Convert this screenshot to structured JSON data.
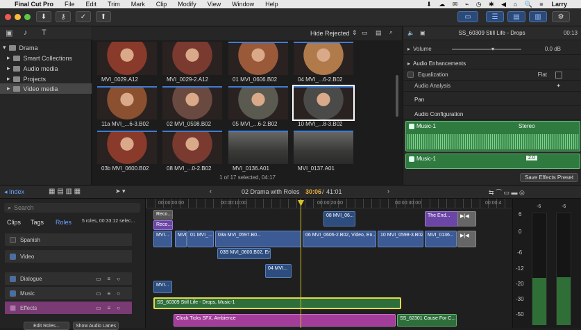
{
  "menubar": {
    "app": "Final Cut Pro",
    "items": [
      "File",
      "Edit",
      "Trim",
      "Mark",
      "Clip",
      "Modify",
      "View",
      "Window",
      "Help"
    ],
    "user": "Larry"
  },
  "library": {
    "name": "Drama",
    "items": [
      "Smart Collections",
      "Audio media",
      "Projects",
      "Video media"
    ],
    "selected": "Video media"
  },
  "browser": {
    "filter": "Hide Rejected",
    "status": "1 of 17 selected, 04:17",
    "clips": [
      "MVI_0029.A12",
      "MVI_0029-2.A12",
      "01 MVI_0606.B02",
      "04 MVI_...6-2.B02",
      "11a MVI_...6-3.B02",
      "02 MVI_0598.B02",
      "05 MVI_...6-2.B02",
      "10 MVI_...8-3.B02",
      "03b MVI_0600.B02",
      "08 MVI_...0-2.B02",
      "MVI_0136.A01",
      "MVI_0137.A01"
    ]
  },
  "inspector": {
    "title": "SS_60309 Still Life - Drops",
    "time": "00:13",
    "volume_label": "Volume",
    "volume_value": "0.0 dB",
    "enh": "Audio Enhancements",
    "eq": "Equalization",
    "eq_value": "Flat",
    "analysis": "Audio Analysis",
    "pan": "Pan",
    "config": "Audio Configuration",
    "music1": "Music-1",
    "stereo": "Stereo",
    "music1b": "Music-1",
    "badge": "2.0",
    "save": "Save Effects Preset"
  },
  "timelinebar": {
    "index": "Index",
    "project": "02 Drama with Roles",
    "timecode": "30:06",
    "duration": "41:01"
  },
  "index": {
    "search": "Search",
    "tabs": [
      "Clips",
      "Tags",
      "Roles"
    ],
    "info": "5 roles, 00:33:12 selec...",
    "roles": [
      "Spanish",
      "Video",
      "Dialogue",
      "Music",
      "Effects"
    ],
    "edit_roles": "Edit Roles...",
    "show_lanes": "Show Audio Lanes"
  },
  "timeline": {
    "ruler": [
      "00:00:00:00",
      "00:00:10:00",
      "00:00:20:00",
      "00:00:30:00",
      "00:00:4"
    ],
    "clips": {
      "reco1": "Reco...",
      "reco2": "Reco...",
      "c08": "08 MVI_06...",
      "end": "The End...",
      "mvi1": "MVI...",
      "mvi2": "MVI...",
      "c01": "01 MVI_...",
      "c03a": "03a MVI_0597.B0...",
      "c06": "06 MVI_0606-2.B02, Video, En...",
      "c10": "10 MVI_0598-3.B02...",
      "c0136": "MVI_0136...",
      "c03b": "03B MVI_0600.B02, En...",
      "c04": "04 MVI...",
      "mvi3": "MVI...",
      "ss": "SS_60309 Still Life - Drops, Music-1",
      "clock": "Clock Ticks SFX, Ambience",
      "cause": "SS_62301 Cause For C..."
    }
  },
  "meters": {
    "labels": [
      "-6",
      "-6",
      "6",
      "0",
      "-6",
      "-12",
      "-20",
      "-30",
      "-50"
    ]
  },
  "colors": {
    "accent": "#3e7dd6",
    "music": "#2f7a3f",
    "effects": "#a23e9a",
    "playhead": "#d9c227"
  }
}
